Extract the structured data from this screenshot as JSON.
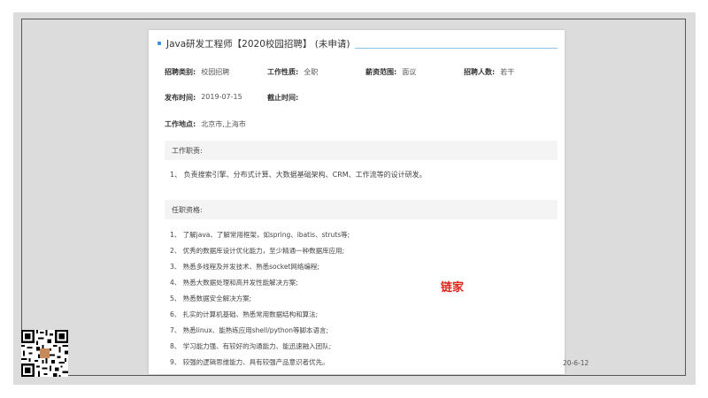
{
  "job": {
    "title": "Java研发工程师【2020校园招聘】 (未申请)",
    "fields": {
      "category_label": "招聘类别:",
      "category_value": "校园招聘",
      "nature_label": "工作性质:",
      "nature_value": "全职",
      "salary_label": "薪资范围:",
      "salary_value": "面议",
      "count_label": "招聘人数:",
      "count_value": "若干",
      "publish_label": "发布时间:",
      "publish_value": "2019-07-15",
      "deadline_label": "截止时间:",
      "deadline_value": "",
      "location_label": "工作地点:",
      "location_value": "北京市,上海市"
    },
    "duties_heading": "工作职责:",
    "duties": [
      "1、 负责搜索引擎、分布式计算、大数据基础架构、CRM、工作流等的设计研发。"
    ],
    "requirements_heading": "任职资格:",
    "requirements": [
      "1、 了解java、了解常用框架，如spring、ibatis、struts等;",
      "2、 优秀的数据库设计优化能力，至少精通一种数据库应用;",
      "3、 熟悉多线程及并发技术、熟悉socket网络编程;",
      "4、 熟悉大数据处理和高并发性能解决方案;",
      "5、 熟悉数据安全解决方案;",
      "6、 扎实的计算机基础、熟悉常用数据结构和算法;",
      "7、 熟悉linux、能熟练应用shell/python等脚本语言;",
      "8、 学习能力强、有较好的沟通能力、能迅速融入团队;",
      "9、 较强的逻辑思维能力、具有较强产品意识者优先。"
    ]
  },
  "watermark": "链家",
  "date_stamp": "20-6-12",
  "colors": {
    "accent": "#3b8fd6",
    "watermark": "#e0251b",
    "backdrop": "#dcdcdc"
  },
  "icons": {
    "qr": "qr-code-icon"
  }
}
